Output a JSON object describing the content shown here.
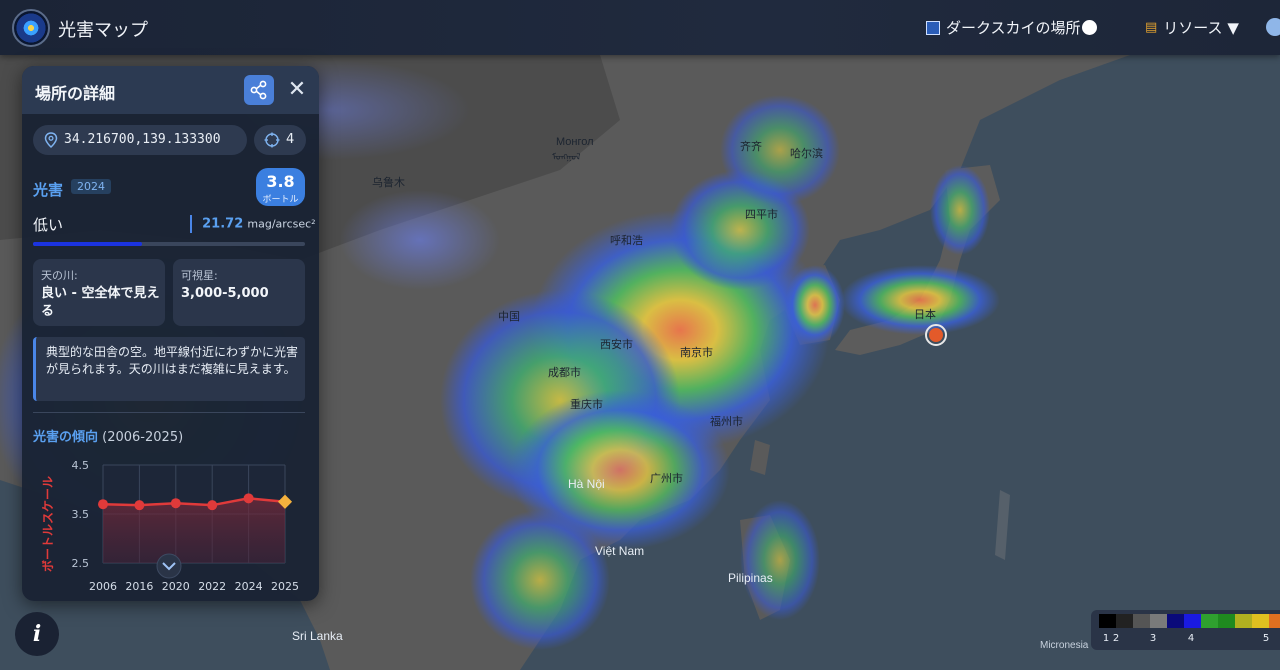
{
  "header": {
    "app_title": "光害マップ",
    "dark_sky_label": "ダークスカイの場所",
    "resources_label": "リソース ▼"
  },
  "map": {
    "labels": [
      {
        "text": "Монгол",
        "name": "label-mongolia"
      },
      {
        "text": "ᠮᠣᠩᠭᠣᠯ",
        "name": "label-mongolia-script"
      },
      {
        "text": "齐齐",
        "name": "label-qiqi"
      },
      {
        "text": "哈尔滨",
        "name": "label-harbin"
      },
      {
        "text": "乌鲁木",
        "name": "label-urumqi"
      },
      {
        "text": "四平市",
        "name": "label-siping"
      },
      {
        "text": "呼和浩",
        "name": "label-hohhot"
      },
      {
        "text": "中国",
        "name": "label-china"
      },
      {
        "text": "西安市",
        "name": "label-xian"
      },
      {
        "text": "成都市",
        "name": "label-chengdu"
      },
      {
        "text": "重庆市",
        "name": "label-chongqing"
      },
      {
        "text": "南京市",
        "name": "label-nanjing"
      },
      {
        "text": "福州市",
        "name": "label-fuzhou"
      },
      {
        "text": "广州市",
        "name": "label-guangzhou"
      },
      {
        "text": "Hà Nội",
        "name": "label-hanoi"
      },
      {
        "text": "Việt Nam",
        "name": "label-vietnam"
      },
      {
        "text": "Pilipinas",
        "name": "label-pilipinas"
      },
      {
        "text": "Sri Lanka",
        "name": "label-srilanka"
      },
      {
        "text": "日本",
        "name": "label-japan"
      },
      {
        "text": "Micronesia",
        "name": "label-micronesia"
      }
    ]
  },
  "panel": {
    "title": "場所の詳細",
    "coordinates": "34.216700,139.133300",
    "zoom": "4",
    "light_pollution_label": "光害",
    "year": "2024",
    "bortle_value": "3.8",
    "bortle_unit": "ボートル",
    "level": "低い",
    "mag_value": "21.72",
    "mag_unit": "mag/arcsec²",
    "mag_bar_fraction": 0.4,
    "milky_way_key": "天の川:",
    "milky_way_value": "良い - 空全体で見える",
    "visible_stars_key": "可視星:",
    "visible_stars_value": "3,000-5,000",
    "description": "典型的な田舎の空。地平線付近にわずかに光害が見られます。天の川はまだ複雑に見えます。",
    "trend_title": "光害の傾向",
    "trend_range": "(2006-2025)"
  },
  "chart_data": {
    "type": "line",
    "ylabel": "ボートルスケール",
    "categories": [
      "2006",
      "2016",
      "2020",
      "2022",
      "2024",
      "2025"
    ],
    "values": [
      3.7,
      3.68,
      3.72,
      3.68,
      3.82,
      3.75
    ],
    "ylim": [
      2.5,
      4.5
    ],
    "yticks": [
      "4.5",
      "3.5",
      "2.5"
    ],
    "series_color": "#e03a3a",
    "highlight_color": "#f5b13d"
  },
  "legend": {
    "ticks": [
      "1",
      "2",
      "3",
      "4",
      "5"
    ],
    "colors": [
      "#000000",
      "#222222",
      "#555555",
      "#7a7a7a",
      "#0a0a7a",
      "#1a1ae0",
      "#2fa02f",
      "#1f8a1f",
      "#b0b020",
      "#e0c020",
      "#e07020"
    ]
  },
  "info_label": "i",
  "theme": {
    "accent": "#5aa0f0",
    "badge": "#3b7fe0"
  }
}
